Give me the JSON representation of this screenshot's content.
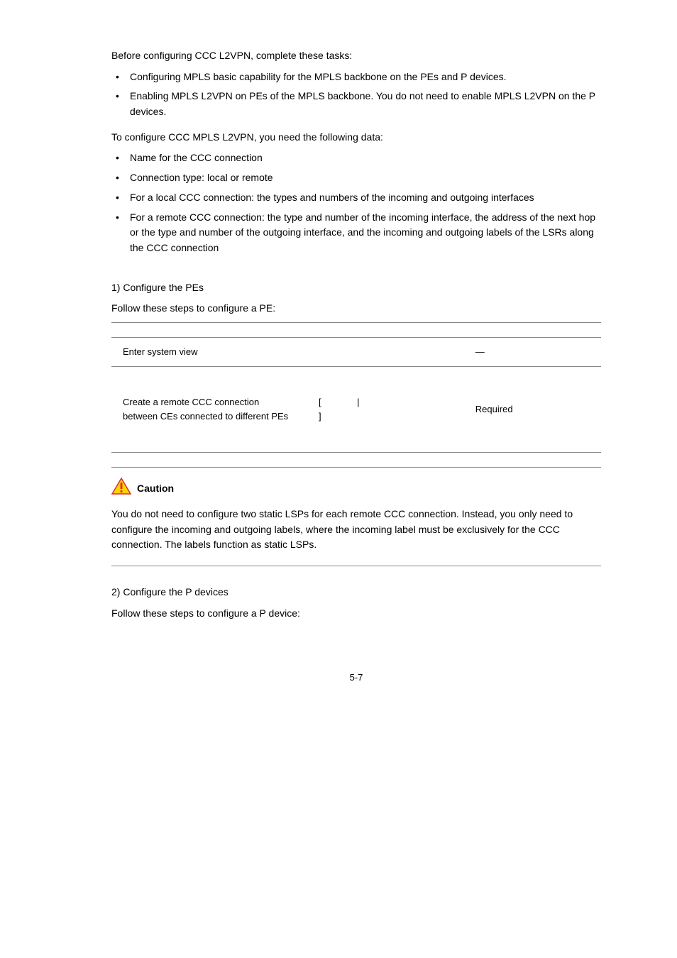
{
  "intro": {
    "lead": "Before configuring CCC L2VPN, complete these tasks:",
    "tasks": [
      "Configuring MPLS basic capability for the MPLS backbone on the PEs and P devices.",
      "Enabling MPLS L2VPN on PEs of the MPLS backbone. You do not need to enable MPLS L2VPN on the P devices."
    ],
    "need": "To configure CCC MPLS L2VPN, you need the following data:",
    "data": [
      "Name for the CCC connection",
      "Connection type: local or remote",
      "For a local CCC connection: the types and numbers of the incoming and outgoing interfaces",
      "For a remote CCC connection: the type and number of the incoming interface, the address of the next hop or the type and number of the outgoing interface, and the incoming and outgoing labels of the LSRs along the CCC connection"
    ]
  },
  "step1": {
    "label": "1)    Configure the PEs",
    "follow": "Follow these steps to configure a PE:"
  },
  "table": {
    "row1": {
      "todo": "Enter system view",
      "cmd": "",
      "remark": "—"
    },
    "row2": {
      "todo": "Create a remote CCC connection between CEs connected to different PEs",
      "cmd": "[              |\n]",
      "remark": "Required"
    }
  },
  "caution": {
    "title": "Caution",
    "body": "You do not need to configure two static LSPs for each remote CCC connection. Instead, you only need to configure the incoming and outgoing labels, where the incoming label must be exclusively for the CCC connection. The labels function as static LSPs."
  },
  "step2": {
    "label": "2)    Configure the P devices",
    "follow": "Follow these steps to configure a P device:"
  },
  "page": "5-7"
}
